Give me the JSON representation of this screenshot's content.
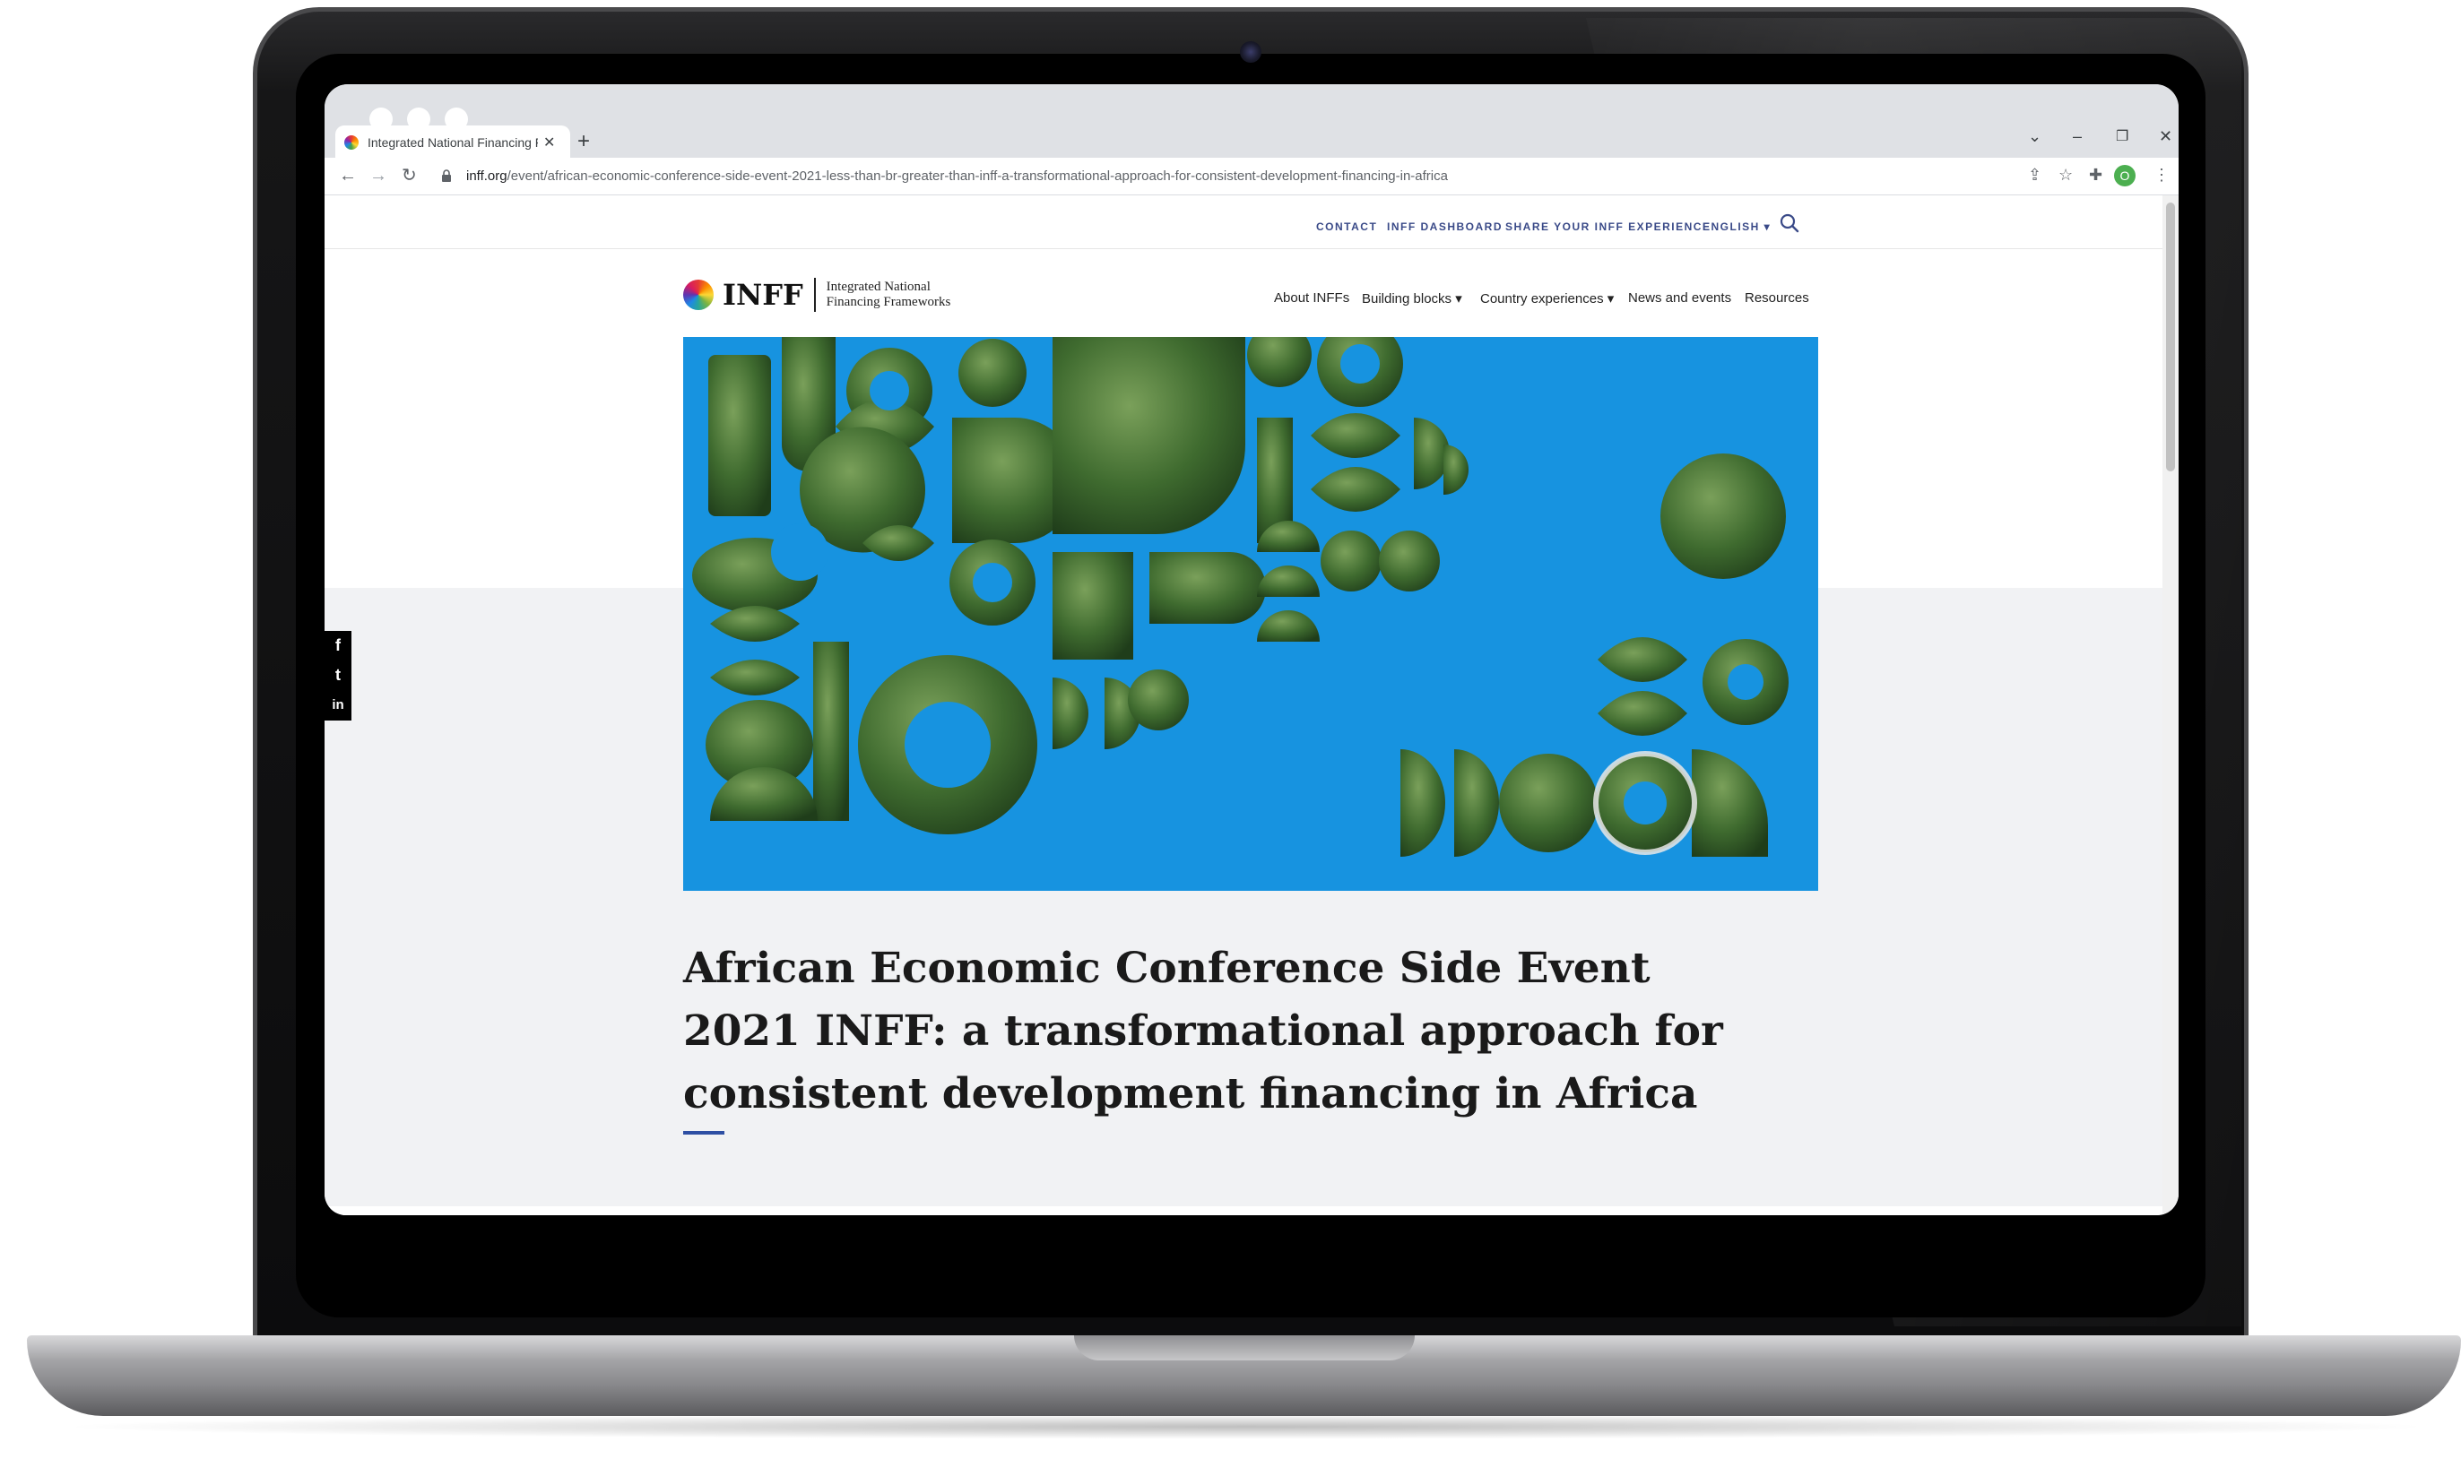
{
  "browser": {
    "tab_title": "Integrated National Financing Fr",
    "new_tab_symbol": "+",
    "close_symbol": "✕",
    "url_host": "inff.org",
    "url_path": "/event/african-economic-conference-side-event-2021-less-than-br-greater-than-inff-a-transformational-approach-for-consistent-development-financing-in-africa",
    "profile_initial": "O",
    "nav": {
      "back": "←",
      "forward": "→",
      "reload": "↻"
    },
    "window": {
      "tab_search": "⌄",
      "minimize": "–",
      "restore": "❐",
      "close": "✕"
    },
    "toolbar_icons": {
      "share": "⇪",
      "bookmark": "☆",
      "extensions": "✚",
      "menu": "⋮"
    }
  },
  "site": {
    "utility_nav": [
      "CONTACT",
      "INFF DASHBOARD",
      "SHARE YOUR INFF EXPERIENCE",
      "ENGLISH ▾"
    ],
    "logo": {
      "word": "INFF",
      "subtitle": "Integrated National Financing Frameworks"
    },
    "main_nav": [
      "About INFFs",
      "Building blocks ▾",
      "Country experiences ▾",
      "News and events",
      "Resources"
    ],
    "social": [
      "f",
      "t",
      "in"
    ],
    "headline": "African Economic Conference Side Event 2021 INFF: a transformational approach for consistent development financing in Africa"
  },
  "colors": {
    "hero_blue": "#1793e0",
    "nav_blue": "#3a4a88",
    "accent_rule": "#2e4fa3",
    "foliage": "#3f6b2f"
  }
}
